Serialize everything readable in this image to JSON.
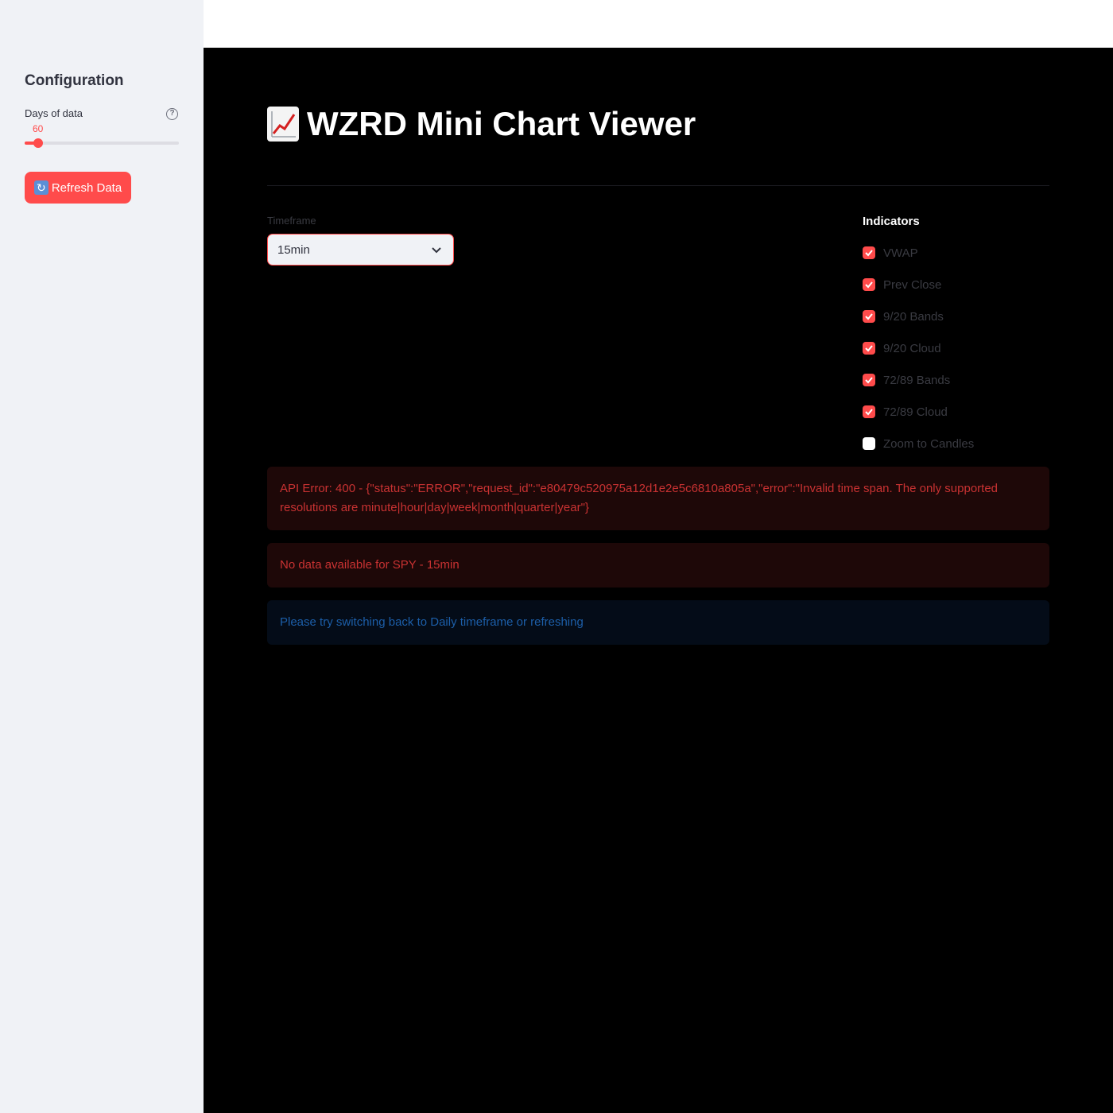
{
  "sidebar": {
    "title": "Configuration",
    "slider": {
      "label": "Days of data",
      "value": "60",
      "fraction": 0.09
    },
    "refresh_button": {
      "icon": "refresh-icon",
      "label": "Refresh Data"
    }
  },
  "main": {
    "title_icon": "chart-increasing-icon",
    "title": "WZRD Mini Chart Viewer",
    "timeframe": {
      "label": "Timeframe",
      "selected": "15min"
    },
    "indicators": {
      "title": "Indicators",
      "items": [
        {
          "label": "VWAP",
          "checked": true
        },
        {
          "label": "Prev Close",
          "checked": true
        },
        {
          "label": "9/20 Bands",
          "checked": true
        },
        {
          "label": "9/20 Cloud",
          "checked": true
        },
        {
          "label": "72/89 Bands",
          "checked": true
        },
        {
          "label": "72/89 Cloud",
          "checked": true
        },
        {
          "label": "Zoom to Candles",
          "checked": false
        }
      ]
    },
    "alerts": {
      "api_error": "API Error: 400 - {\"status\":\"ERROR\",\"request_id\":\"e80479c520975a12d1e2e5c6810a805a\",\"error\":\"Invalid time span. The only supported resolutions are minute|hour|day|week|month|quarter|year\"}",
      "no_data": "No data available for SPY - 15min",
      "info": "Please try switching back to Daily timeframe or refreshing"
    }
  },
  "colors": {
    "accent": "#ff4b4b",
    "sidebar_bg": "#f0f2f6",
    "main_bg": "#000000",
    "error_text": "#c93232",
    "info_text": "#1c5ea8"
  }
}
